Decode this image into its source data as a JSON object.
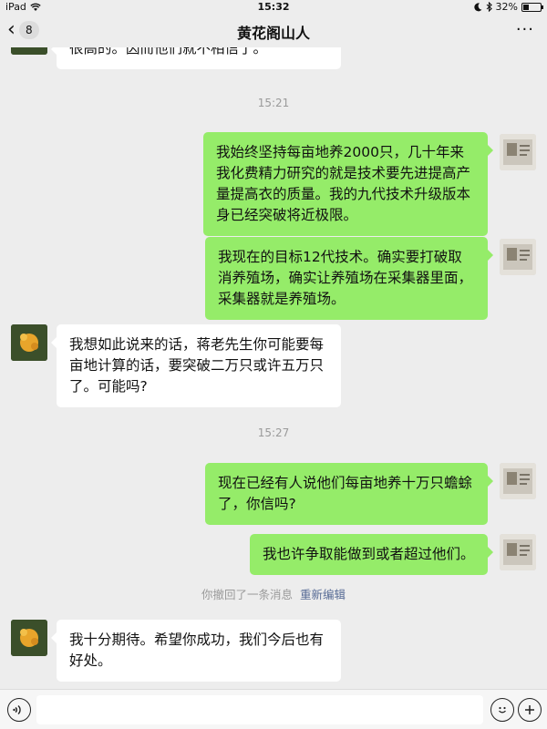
{
  "status_bar": {
    "device": "iPad",
    "time": "15:32",
    "battery": "32%"
  },
  "nav": {
    "unread_count": "8",
    "title": "黄花阁山人",
    "more": "···"
  },
  "messages": {
    "partial_top": "很高的。因而他们就不相信了。",
    "time1": "15:21",
    "out1": "我始终坚持每亩地养2000只，几十年来我化费精力研究的就是技术要先进提高产量提高衣的质量。我的九代技术升级版本身已经突破将近极限。",
    "out2": "我现在的目标12代技术。确实要打破取消养殖场，确实让养殖场在采集器里面，采集器就是养殖场。",
    "in1": "我想如此说来的话，蒋老先生你可能要每亩地计算的话，要突破二万只或许五万只了。可能吗?",
    "time2": "15:27",
    "out3": "现在已经有人说他们每亩地养十万只蟾蜍了，你信吗?",
    "out4": "我也许争取能做到或者超过他们。",
    "recall_text": "你撤回了一条消息",
    "recall_reedit": "重新编辑",
    "in2": "我十分期待。希望你成功，我们今后也有好处。"
  },
  "input_bar": {
    "placeholder": ""
  }
}
